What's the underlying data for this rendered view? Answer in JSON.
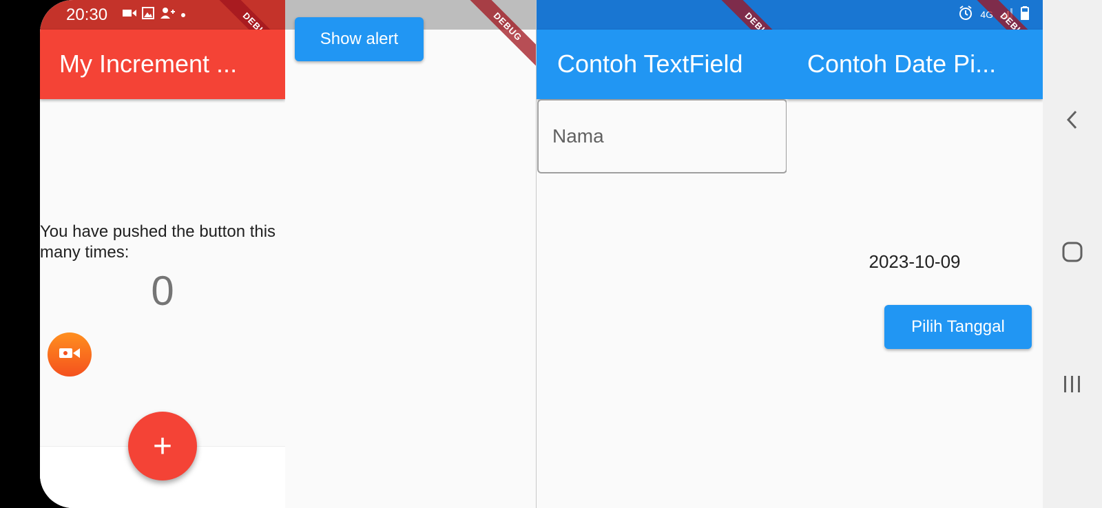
{
  "status_bar": {
    "time": "20:30",
    "network": "4G"
  },
  "panel_counter": {
    "title": "My Increment ...",
    "debug": "DEBUG",
    "message": "You have pushed the button this many times:",
    "count": "0",
    "fab_label": "+"
  },
  "panel_alert": {
    "debug": "DEBUG",
    "button_label": "Show alert"
  },
  "panel_textfield": {
    "title": "Contoh TextField",
    "debug": "DEBUG",
    "field_placeholder": "Nama"
  },
  "panel_datepicker": {
    "title": "Contoh Date Pi...",
    "debug": "DEBUG",
    "date": "2023-10-09",
    "button_label": "Pilih Tanggal"
  },
  "colors": {
    "red": "#f44336",
    "blue": "#2196f3",
    "orange": "#ff8f1f"
  }
}
